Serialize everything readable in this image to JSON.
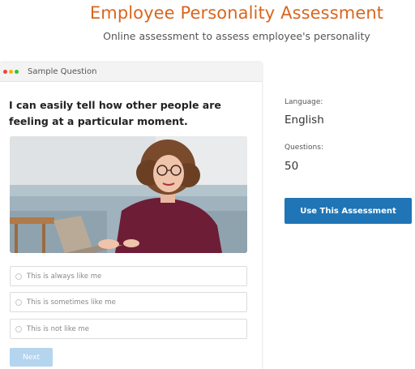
{
  "header": {
    "title": "Employee Personality Assessment",
    "subtitle": "Online assessment to assess employee's personality"
  },
  "sample_card": {
    "window_label": "Sample Question",
    "question": "I can easily tell how other people are feeling at a particular moment.",
    "options": [
      "This is always like me",
      "This is sometimes like me",
      "This is not like me"
    ],
    "next_label": "Next"
  },
  "details": {
    "language_label": "Language:",
    "language_value": "English",
    "questions_label": "Questions:",
    "questions_value": "50",
    "use_button_label": "Use This Assessment"
  },
  "colors": {
    "title": "#d9661f",
    "primary_button": "#1f75b6",
    "disabled_button": "#b5d4ee"
  },
  "icons": [
    "window-dot-red-icon",
    "window-dot-yellow-icon",
    "window-dot-green-icon",
    "radio-icon"
  ]
}
